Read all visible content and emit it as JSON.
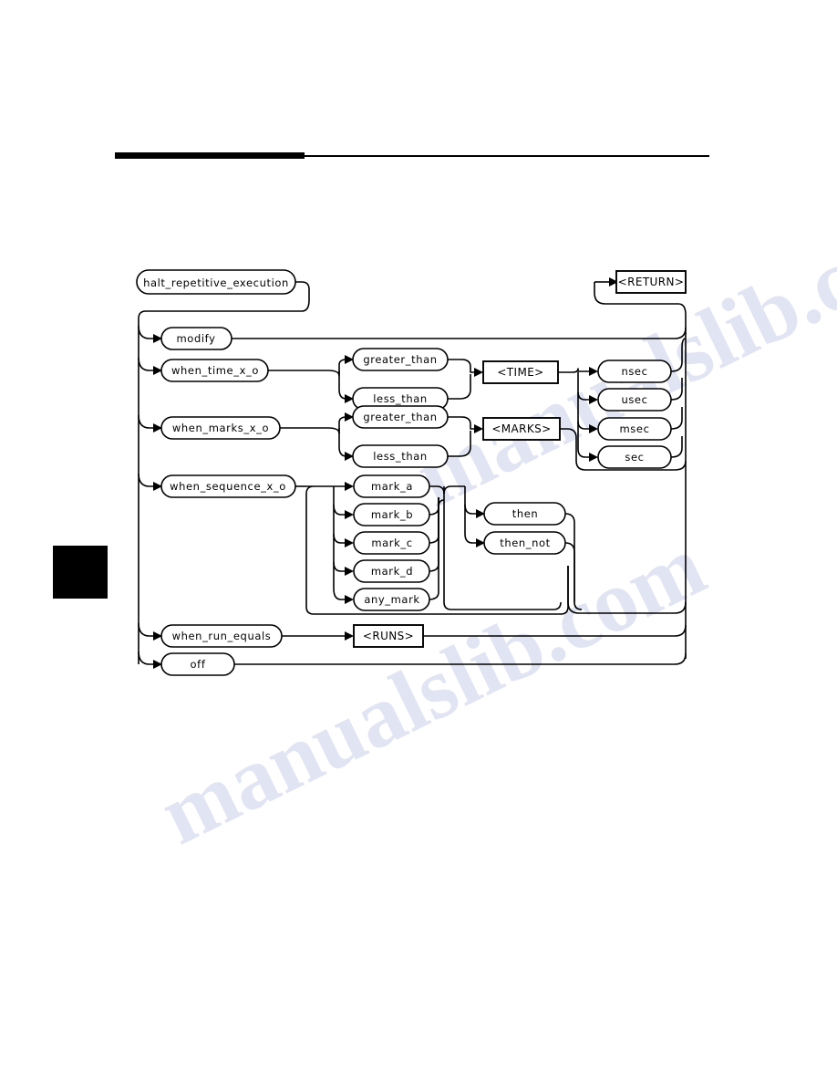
{
  "page": {
    "background_color": "#ffffff",
    "ink_color": "#000000",
    "watermark_text": "manualslib.com"
  },
  "header": {
    "rule_thick_color": "#000000",
    "rule_thin_color": "#000000"
  },
  "margin": {
    "tab_marker_color": "#000000"
  },
  "diagram": {
    "type": "railroad-syntax-diagram",
    "entry": {
      "label": "halt_repetitive_execution",
      "shape": "pill"
    },
    "terminator": {
      "label": "<RETURN>",
      "shape": "box"
    },
    "branches": [
      {
        "label": "modify",
        "shape": "pill"
      },
      {
        "label": "when_time_x_o",
        "shape": "pill"
      },
      {
        "label": "when_marks_x_o",
        "shape": "pill"
      },
      {
        "label": "when_sequence_x_o",
        "shape": "pill"
      },
      {
        "label": "when_run_equals",
        "shape": "pill"
      },
      {
        "label": "off",
        "shape": "pill"
      }
    ],
    "comparators_time": [
      {
        "label": "greater_than",
        "shape": "pill"
      },
      {
        "label": "less_than",
        "shape": "pill"
      }
    ],
    "comparators_marks": [
      {
        "label": "greater_than",
        "shape": "pill"
      },
      {
        "label": "less_than",
        "shape": "pill"
      }
    ],
    "value_time": {
      "label": "<TIME>",
      "shape": "box"
    },
    "value_marks": {
      "label": "<MARKS>",
      "shape": "box"
    },
    "value_runs": {
      "label": "<RUNS>",
      "shape": "box"
    },
    "time_units": [
      {
        "label": "nsec",
        "shape": "pill"
      },
      {
        "label": "usec",
        "shape": "pill"
      },
      {
        "label": "msec",
        "shape": "pill"
      },
      {
        "label": "sec",
        "shape": "pill"
      }
    ],
    "marks": [
      {
        "label": "mark_a",
        "shape": "pill"
      },
      {
        "label": "mark_b",
        "shape": "pill"
      },
      {
        "label": "mark_c",
        "shape": "pill"
      },
      {
        "label": "mark_d",
        "shape": "pill"
      },
      {
        "label": "any_mark",
        "shape": "pill"
      }
    ],
    "sequence_connectors": [
      {
        "label": "then",
        "shape": "pill"
      },
      {
        "label": "then_not",
        "shape": "pill"
      }
    ]
  }
}
